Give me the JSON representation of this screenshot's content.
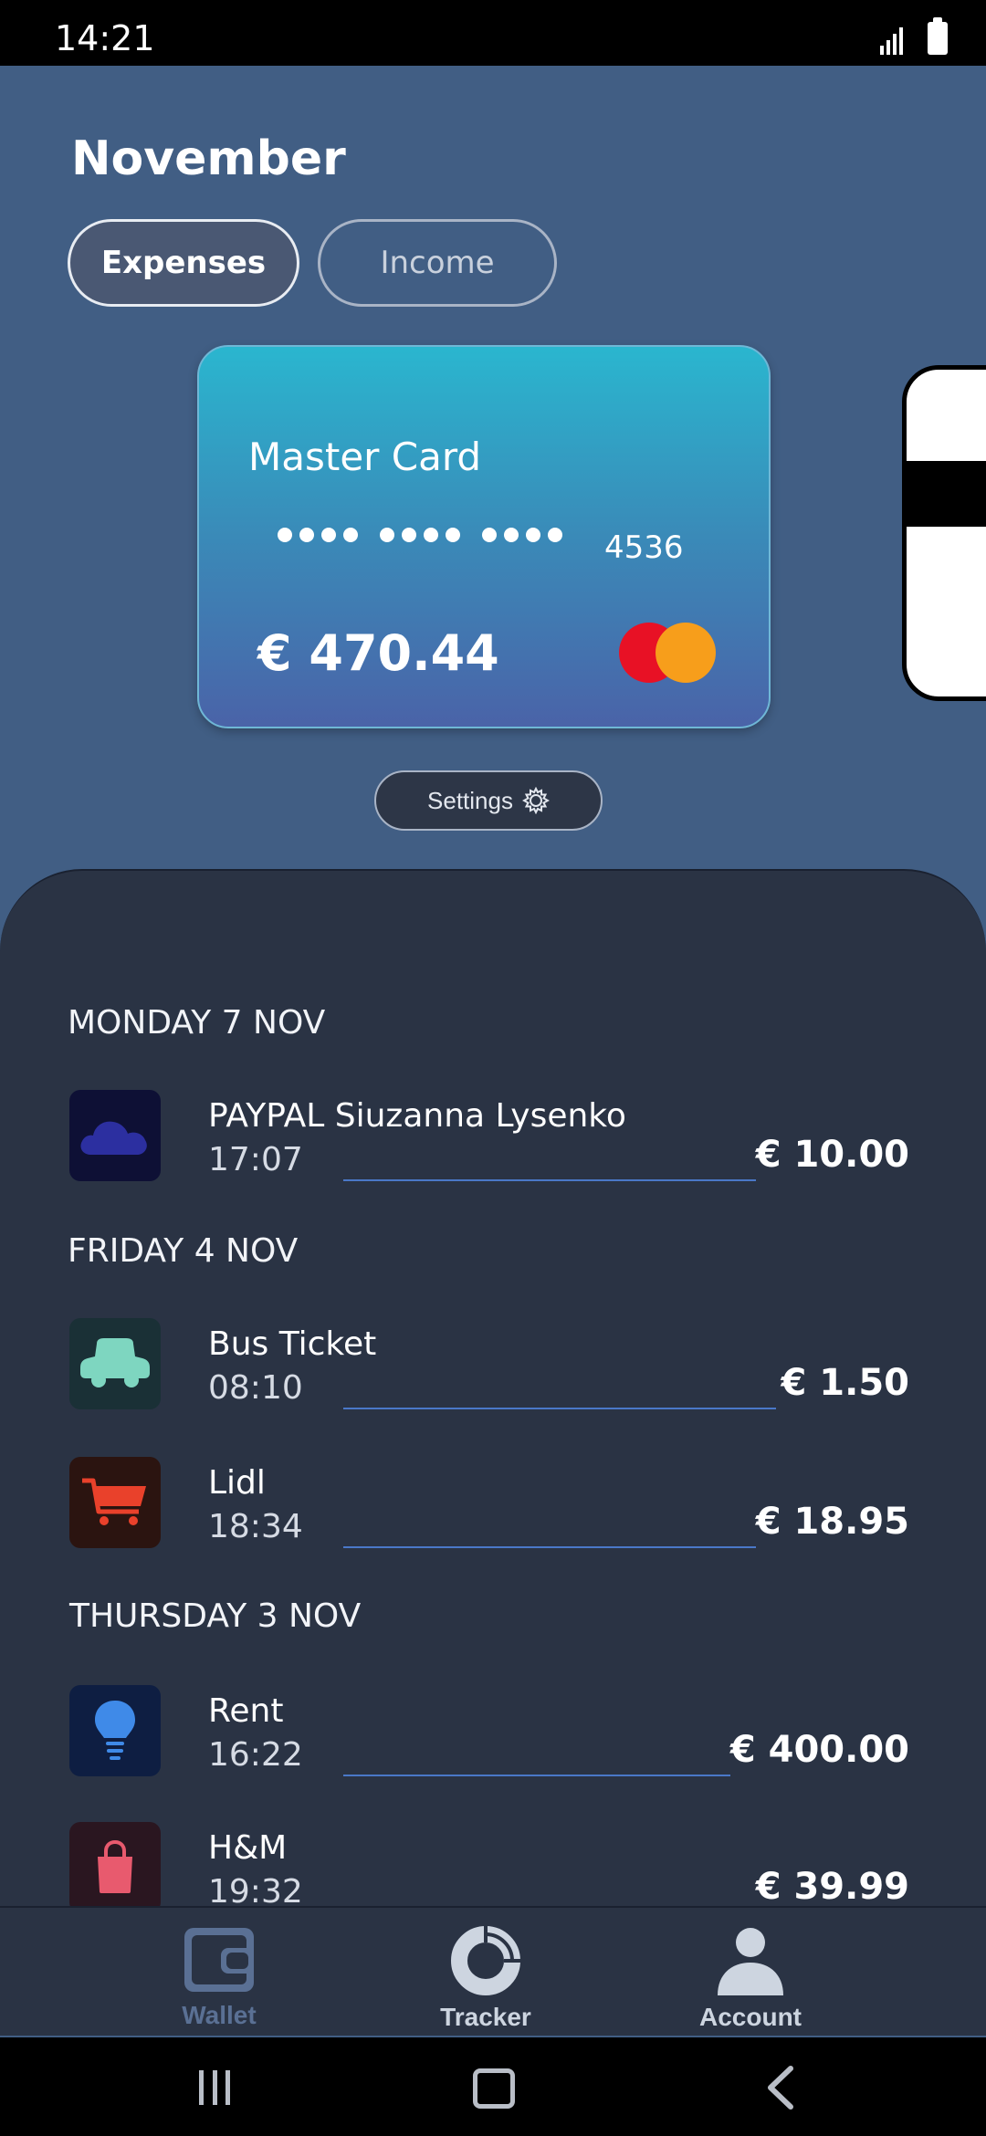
{
  "status_bar": {
    "time": "14:21"
  },
  "header": {
    "month": "November"
  },
  "tabs": [
    {
      "label": "Expenses",
      "active": true
    },
    {
      "label": "Income",
      "active": false
    }
  ],
  "card": {
    "name": "Master Card",
    "last4": "4536",
    "balance": "€ 470.44",
    "brand_icon": "mastercard-logo"
  },
  "settings": {
    "label": "Settings",
    "icon": "gear-icon"
  },
  "days": [
    {
      "label": "MONDAY 7 NOV",
      "transactions": [
        {
          "title": "PAYPAL Siuzanna Lysenko",
          "time": "17:07",
          "amount": "€ 10.00",
          "icon": "cloud-icon",
          "icon_bg": "#0e1035",
          "icon_color": "#2c2fa0"
        }
      ]
    },
    {
      "label": "FRIDAY 4 NOV",
      "transactions": [
        {
          "title": "Bus Ticket",
          "time": "08:10",
          "amount": "€ 1.50",
          "icon": "car-icon",
          "icon_bg": "#1a3036",
          "icon_color": "#7ed6c0"
        },
        {
          "title": "Lidl",
          "time": "18:34",
          "amount": "€ 18.95",
          "icon": "shopping-cart-icon",
          "icon_bg": "#2b1410",
          "icon_color": "#e9412b"
        }
      ]
    },
    {
      "label": "THURSDAY 3 NOV",
      "transactions": [
        {
          "title": "Rent",
          "time": "16:22",
          "amount": "€ 400.00",
          "icon": "lightbulb-icon",
          "icon_bg": "#0e1e42",
          "icon_color": "#3f8ae8"
        },
        {
          "title": "H&M",
          "time": "19:32",
          "amount": "€ 39.99",
          "icon": "shopping-bag-icon",
          "icon_bg": "#2a1620",
          "icon_color": "#e85a6e"
        }
      ]
    }
  ],
  "bottom_nav": [
    {
      "label": "Wallet",
      "icon": "wallet-icon",
      "active": true
    },
    {
      "label": "Tracker",
      "icon": "donut-chart-icon",
      "active": false
    },
    {
      "label": "Account",
      "icon": "person-icon",
      "active": false
    }
  ],
  "colors": {
    "background": "#415e84",
    "sheet": "#2a3344",
    "accent_line": "#4a78c8"
  }
}
